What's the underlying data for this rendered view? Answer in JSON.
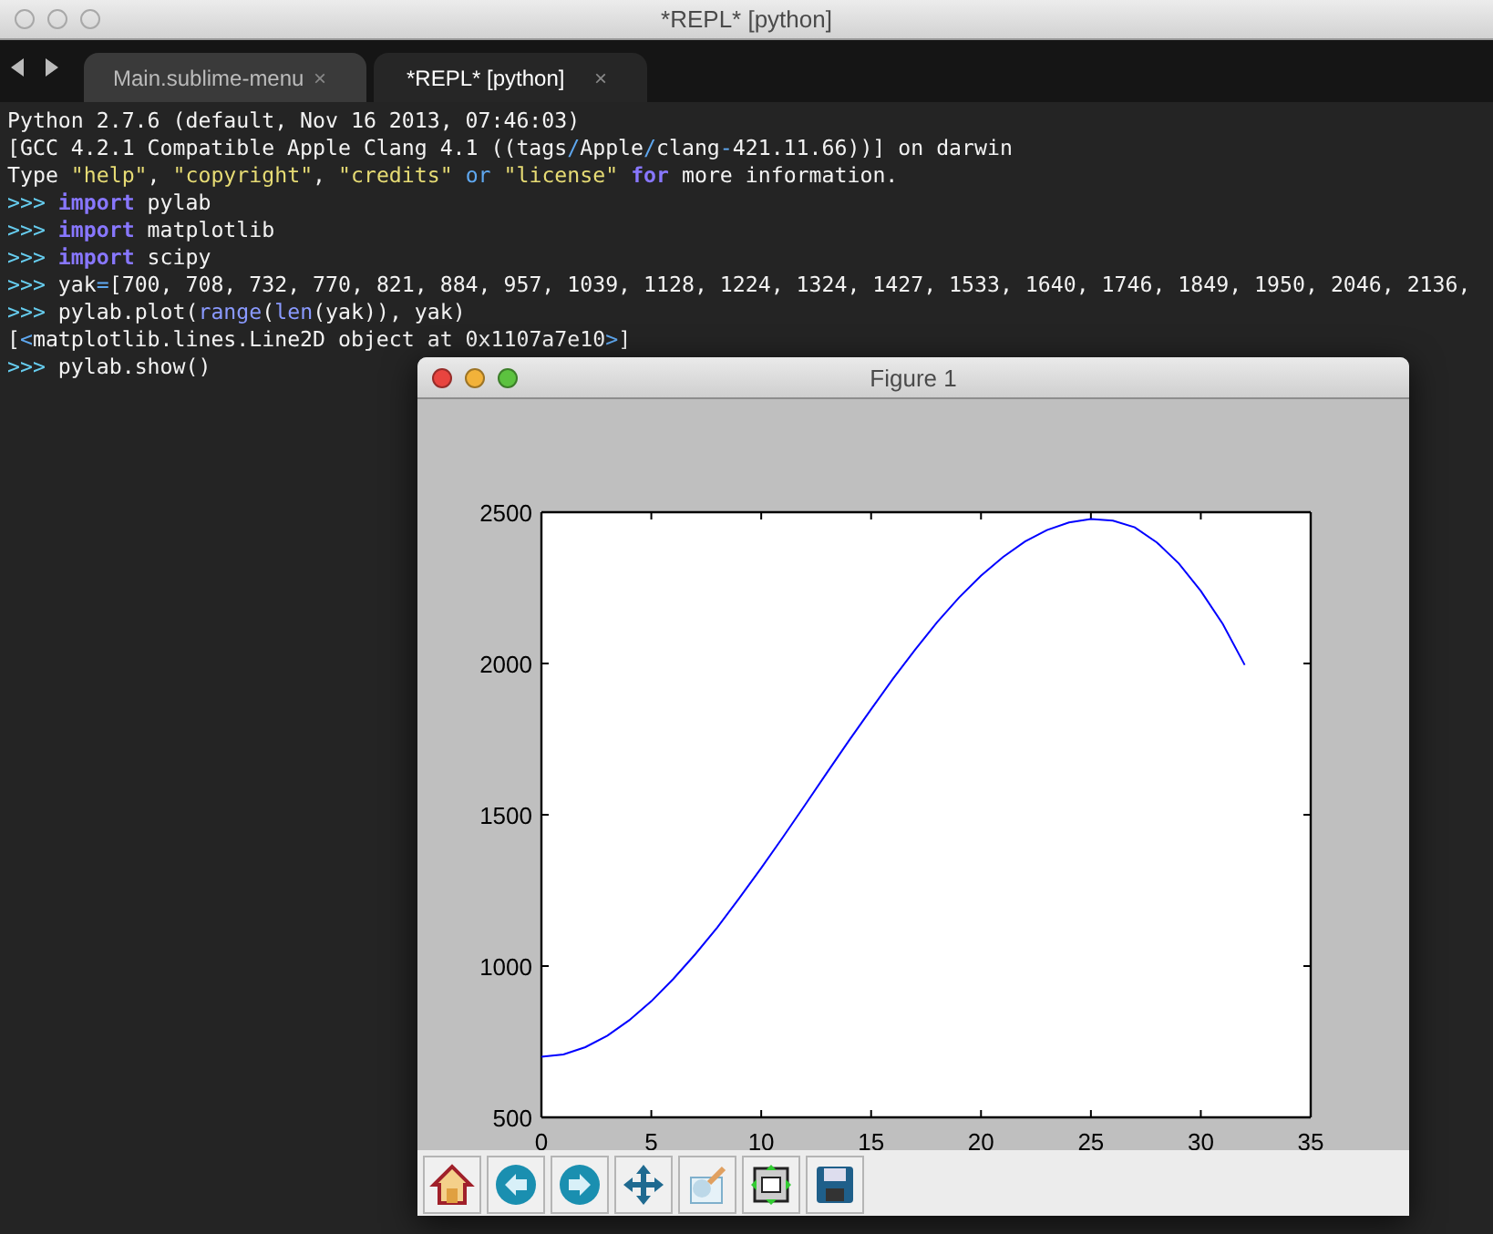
{
  "window": {
    "title": "*REPL* [python]"
  },
  "tabs": [
    {
      "label": "Main.sublime-menu",
      "close": "×",
      "selected": false
    },
    {
      "label": "*REPL* [python]",
      "close": "×",
      "selected": true
    }
  ],
  "console": {
    "lines": [
      [
        {
          "kind": "plain",
          "text": "Python 2.7.6 (default, Nov 16 2013, 07:46:03)"
        }
      ],
      [
        {
          "kind": "plain",
          "text": "[GCC 4.2.1 Compatible Apple Clang 4.1 ((tags"
        },
        {
          "kind": "operator",
          "text": "/"
        },
        {
          "kind": "plain",
          "text": "Apple"
        },
        {
          "kind": "operator",
          "text": "/"
        },
        {
          "kind": "plain",
          "text": "clang"
        },
        {
          "kind": "operator",
          "text": "-"
        },
        {
          "kind": "plain",
          "text": "421.11.66))] on darwin"
        }
      ],
      [
        {
          "kind": "plain",
          "text": "Type "
        },
        {
          "kind": "string",
          "text": "\"help\""
        },
        {
          "kind": "plain",
          "text": ", "
        },
        {
          "kind": "string",
          "text": "\"copyright\""
        },
        {
          "kind": "plain",
          "text": ", "
        },
        {
          "kind": "string",
          "text": "\"credits\""
        },
        {
          "kind": "operator",
          "text": " or "
        },
        {
          "kind": "string",
          "text": "\"license\""
        },
        {
          "kind": "keyword",
          "text": " for"
        },
        {
          "kind": "plain",
          "text": " more information."
        }
      ],
      [
        {
          "kind": "prompt",
          "text": ">>> "
        },
        {
          "kind": "keyword",
          "text": "import"
        },
        {
          "kind": "plain",
          "text": " pylab"
        }
      ],
      [
        {
          "kind": "prompt",
          "text": ">>> "
        },
        {
          "kind": "keyword",
          "text": "import"
        },
        {
          "kind": "plain",
          "text": " matplotlib"
        }
      ],
      [
        {
          "kind": "prompt",
          "text": ">>> "
        },
        {
          "kind": "keyword",
          "text": "import"
        },
        {
          "kind": "plain",
          "text": " scipy"
        }
      ],
      [
        {
          "kind": "prompt",
          "text": ">>>"
        },
        {
          "kind": "plain",
          "text": " yak"
        },
        {
          "kind": "operator",
          "text": "="
        },
        {
          "kind": "plain",
          "text": "[700, 708, 732, 770, 821, 884, 957, 1039, 1128, 1224, 1324, 1427, 1533, 1640, 1746, 1849, 1950, 2046, 2136,"
        }
      ],
      [
        {
          "kind": "prompt",
          "text": ">>>"
        },
        {
          "kind": "plain",
          "text": " pylab.plot("
        },
        {
          "kind": "builtin",
          "text": "range"
        },
        {
          "kind": "plain",
          "text": "("
        },
        {
          "kind": "builtin",
          "text": "len"
        },
        {
          "kind": "plain",
          "text": "(yak)), yak)"
        }
      ],
      [
        {
          "kind": "plain",
          "text": "["
        },
        {
          "kind": "operator",
          "text": "<"
        },
        {
          "kind": "plain",
          "text": "matplotlib.lines.Line2D object at 0x1107a7e10"
        },
        {
          "kind": "operator",
          "text": ">"
        },
        {
          "kind": "plain",
          "text": "]"
        }
      ],
      [
        {
          "kind": "prompt",
          "text": ">>>"
        },
        {
          "kind": "plain",
          "text": " pylab.show()"
        }
      ]
    ]
  },
  "figure": {
    "title": "Figure 1",
    "chart_data": {
      "type": "line",
      "xlim": [
        0,
        35
      ],
      "ylim": [
        500,
        2500
      ],
      "xticks": [
        0,
        5,
        10,
        15,
        20,
        25,
        30,
        35
      ],
      "yticks": [
        500,
        1000,
        1500,
        2000,
        2500
      ],
      "x": [
        0,
        1,
        2,
        3,
        4,
        5,
        6,
        7,
        8,
        9,
        10,
        11,
        12,
        13,
        14,
        15,
        16,
        17,
        18,
        19,
        20,
        21,
        22,
        23,
        24,
        25,
        26,
        27,
        28,
        29,
        30,
        31,
        32
      ],
      "series": [
        {
          "color": "#0000ff",
          "values": [
            700,
            708,
            732,
            770,
            821,
            884,
            957,
            1039,
            1128,
            1224,
            1324,
            1427,
            1533,
            1640,
            1746,
            1849,
            1950,
            2046,
            2136,
            2218,
            2290,
            2352,
            2403,
            2441,
            2466,
            2477,
            2472,
            2450,
            2400,
            2330,
            2240,
            2130,
            1995
          ]
        }
      ]
    },
    "toolbar": [
      {
        "kind": "home"
      },
      {
        "kind": "back"
      },
      {
        "kind": "forward"
      },
      {
        "kind": "pan"
      },
      {
        "kind": "zoom"
      },
      {
        "kind": "subplots"
      },
      {
        "kind": "save"
      }
    ]
  }
}
